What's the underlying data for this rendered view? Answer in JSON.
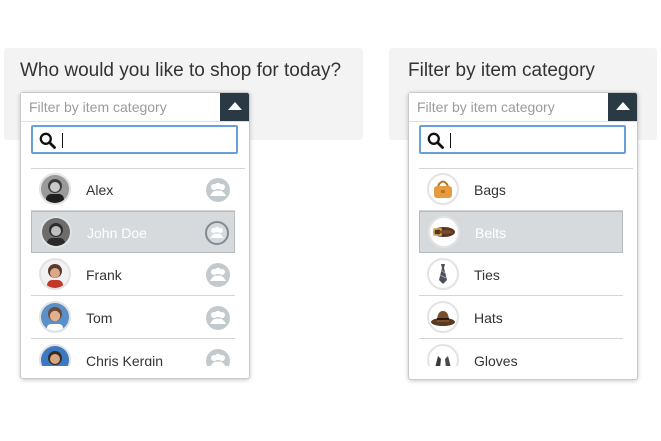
{
  "left_panel": {
    "title": "Who would you like to shop for today?",
    "select_placeholder": "Filter by item category",
    "items": [
      {
        "label": "Alex",
        "selected": false
      },
      {
        "label": "John Doe",
        "selected": true
      },
      {
        "label": "Frank",
        "selected": false
      },
      {
        "label": "Tom",
        "selected": false
      },
      {
        "label": "Chris Kergin",
        "selected": false
      }
    ]
  },
  "right_panel": {
    "title": "Filter by item category",
    "select_placeholder": "Filter by item category",
    "items": [
      {
        "label": "Bags",
        "icon": "bag-icon",
        "selected": false
      },
      {
        "label": "Belts",
        "icon": "belt-icon",
        "selected": true
      },
      {
        "label": "Ties",
        "icon": "tie-icon",
        "selected": false
      },
      {
        "label": "Hats",
        "icon": "hat-icon",
        "selected": false
      },
      {
        "label": "Gloves",
        "icon": "gloves-icon",
        "selected": false
      }
    ]
  },
  "colors": {
    "toggle_bg": "#2a3a45",
    "selected_row": "#d6dadc",
    "search_border": "#6aa0d9",
    "panel_bg": "#f3f3f3"
  }
}
